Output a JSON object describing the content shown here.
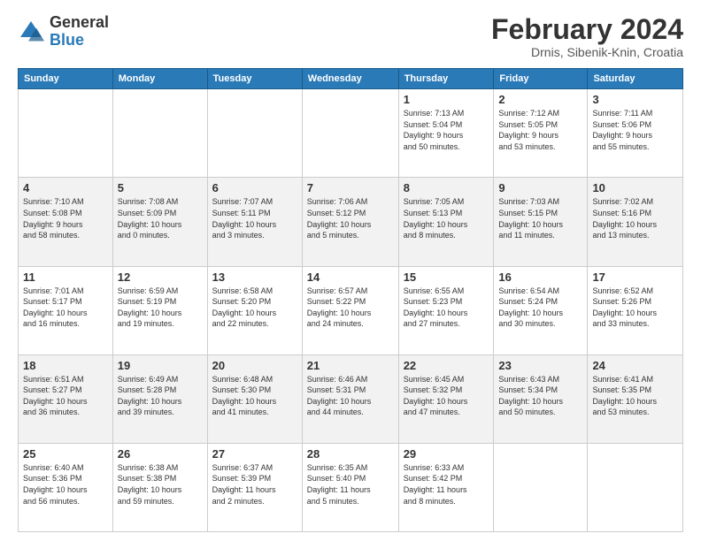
{
  "header": {
    "logo_general": "General",
    "logo_blue": "Blue",
    "month_year": "February 2024",
    "location": "Drnis, Sibenik-Knin, Croatia"
  },
  "days_of_week": [
    "Sunday",
    "Monday",
    "Tuesday",
    "Wednesday",
    "Thursday",
    "Friday",
    "Saturday"
  ],
  "weeks": [
    [
      {
        "day": "",
        "info": ""
      },
      {
        "day": "",
        "info": ""
      },
      {
        "day": "",
        "info": ""
      },
      {
        "day": "",
        "info": ""
      },
      {
        "day": "1",
        "info": "Sunrise: 7:13 AM\nSunset: 5:04 PM\nDaylight: 9 hours\nand 50 minutes."
      },
      {
        "day": "2",
        "info": "Sunrise: 7:12 AM\nSunset: 5:05 PM\nDaylight: 9 hours\nand 53 minutes."
      },
      {
        "day": "3",
        "info": "Sunrise: 7:11 AM\nSunset: 5:06 PM\nDaylight: 9 hours\nand 55 minutes."
      }
    ],
    [
      {
        "day": "4",
        "info": "Sunrise: 7:10 AM\nSunset: 5:08 PM\nDaylight: 9 hours\nand 58 minutes."
      },
      {
        "day": "5",
        "info": "Sunrise: 7:08 AM\nSunset: 5:09 PM\nDaylight: 10 hours\nand 0 minutes."
      },
      {
        "day": "6",
        "info": "Sunrise: 7:07 AM\nSunset: 5:11 PM\nDaylight: 10 hours\nand 3 minutes."
      },
      {
        "day": "7",
        "info": "Sunrise: 7:06 AM\nSunset: 5:12 PM\nDaylight: 10 hours\nand 5 minutes."
      },
      {
        "day": "8",
        "info": "Sunrise: 7:05 AM\nSunset: 5:13 PM\nDaylight: 10 hours\nand 8 minutes."
      },
      {
        "day": "9",
        "info": "Sunrise: 7:03 AM\nSunset: 5:15 PM\nDaylight: 10 hours\nand 11 minutes."
      },
      {
        "day": "10",
        "info": "Sunrise: 7:02 AM\nSunset: 5:16 PM\nDaylight: 10 hours\nand 13 minutes."
      }
    ],
    [
      {
        "day": "11",
        "info": "Sunrise: 7:01 AM\nSunset: 5:17 PM\nDaylight: 10 hours\nand 16 minutes."
      },
      {
        "day": "12",
        "info": "Sunrise: 6:59 AM\nSunset: 5:19 PM\nDaylight: 10 hours\nand 19 minutes."
      },
      {
        "day": "13",
        "info": "Sunrise: 6:58 AM\nSunset: 5:20 PM\nDaylight: 10 hours\nand 22 minutes."
      },
      {
        "day": "14",
        "info": "Sunrise: 6:57 AM\nSunset: 5:22 PM\nDaylight: 10 hours\nand 24 minutes."
      },
      {
        "day": "15",
        "info": "Sunrise: 6:55 AM\nSunset: 5:23 PM\nDaylight: 10 hours\nand 27 minutes."
      },
      {
        "day": "16",
        "info": "Sunrise: 6:54 AM\nSunset: 5:24 PM\nDaylight: 10 hours\nand 30 minutes."
      },
      {
        "day": "17",
        "info": "Sunrise: 6:52 AM\nSunset: 5:26 PM\nDaylight: 10 hours\nand 33 minutes."
      }
    ],
    [
      {
        "day": "18",
        "info": "Sunrise: 6:51 AM\nSunset: 5:27 PM\nDaylight: 10 hours\nand 36 minutes."
      },
      {
        "day": "19",
        "info": "Sunrise: 6:49 AM\nSunset: 5:28 PM\nDaylight: 10 hours\nand 39 minutes."
      },
      {
        "day": "20",
        "info": "Sunrise: 6:48 AM\nSunset: 5:30 PM\nDaylight: 10 hours\nand 41 minutes."
      },
      {
        "day": "21",
        "info": "Sunrise: 6:46 AM\nSunset: 5:31 PM\nDaylight: 10 hours\nand 44 minutes."
      },
      {
        "day": "22",
        "info": "Sunrise: 6:45 AM\nSunset: 5:32 PM\nDaylight: 10 hours\nand 47 minutes."
      },
      {
        "day": "23",
        "info": "Sunrise: 6:43 AM\nSunset: 5:34 PM\nDaylight: 10 hours\nand 50 minutes."
      },
      {
        "day": "24",
        "info": "Sunrise: 6:41 AM\nSunset: 5:35 PM\nDaylight: 10 hours\nand 53 minutes."
      }
    ],
    [
      {
        "day": "25",
        "info": "Sunrise: 6:40 AM\nSunset: 5:36 PM\nDaylight: 10 hours\nand 56 minutes."
      },
      {
        "day": "26",
        "info": "Sunrise: 6:38 AM\nSunset: 5:38 PM\nDaylight: 10 hours\nand 59 minutes."
      },
      {
        "day": "27",
        "info": "Sunrise: 6:37 AM\nSunset: 5:39 PM\nDaylight: 11 hours\nand 2 minutes."
      },
      {
        "day": "28",
        "info": "Sunrise: 6:35 AM\nSunset: 5:40 PM\nDaylight: 11 hours\nand 5 minutes."
      },
      {
        "day": "29",
        "info": "Sunrise: 6:33 AM\nSunset: 5:42 PM\nDaylight: 11 hours\nand 8 minutes."
      },
      {
        "day": "",
        "info": ""
      },
      {
        "day": "",
        "info": ""
      }
    ]
  ]
}
